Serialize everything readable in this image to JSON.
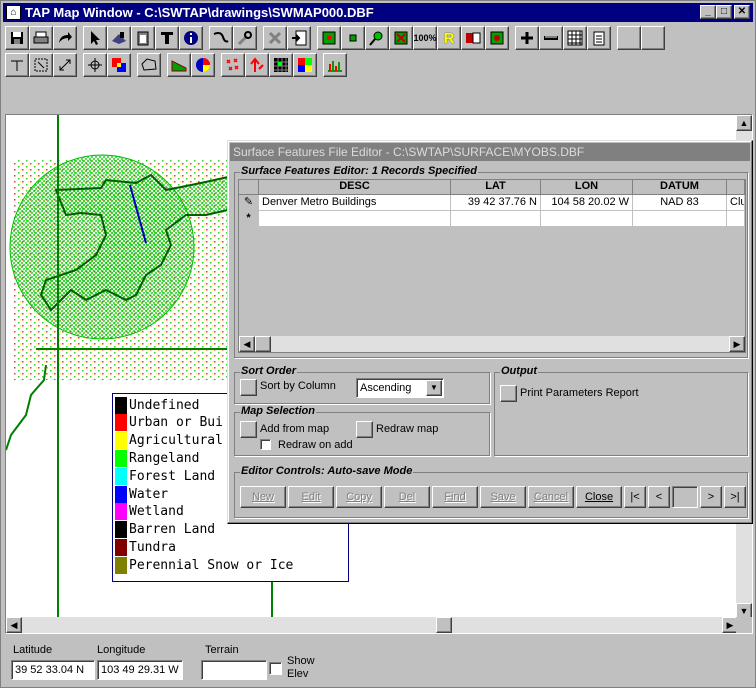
{
  "window": {
    "title": "TAP Map Window - C:\\SWTAP\\drawings\\SWMAP000.DBF",
    "minimize": "_",
    "maximize": "□",
    "close": "✕"
  },
  "toolbar1": [
    "save-icon",
    "print-icon",
    "redo-icon",
    "pointer-icon",
    "pan-icon",
    "clipboard-icon",
    "text-icon",
    "info-icon",
    "route-icon",
    "tools-icon",
    "delete-icon",
    "import-icon",
    "layer-grid-icon",
    "point-icon",
    "locate-icon",
    "remove-icon",
    "zoom-100-icon",
    "label-r-icon",
    "export-icon",
    "grid-icon",
    "add-icon",
    "ruler-icon",
    "table-icon",
    "notes-icon",
    "blank-icon",
    "blank-icon"
  ],
  "toolbar1_labels": {
    "zoom100": "100%",
    "label_r": "R"
  },
  "toolbar2": [
    "line-icon",
    "select-box-icon",
    "resize-icon",
    "move-icon",
    "layers-icon",
    "polygon-icon",
    "profile-icon",
    "globe-icon",
    "points-icon",
    "elevation-icon",
    "grid-color-icon",
    "terrain-icon",
    "histogram-icon"
  ],
  "legend": {
    "items": [
      {
        "label": "Undefined",
        "color": "#000000"
      },
      {
        "label": "Urban or Bui",
        "color": "#ff0000"
      },
      {
        "label": "Agricultural",
        "color": "#ffff00"
      },
      {
        "label": "Rangeland",
        "color": "#00ff00"
      },
      {
        "label": "Forest Land",
        "color": "#00ffff"
      },
      {
        "label": "Water",
        "color": "#0000ff"
      },
      {
        "label": "Wetland",
        "color": "#ff00ff"
      },
      {
        "label": "Barren Land",
        "color": "#000000"
      },
      {
        "label": "Tundra",
        "color": "#800000"
      },
      {
        "label": "Perennial Snow or Ice",
        "color": "#808000"
      }
    ]
  },
  "status": {
    "latitude_label": "Latitude",
    "latitude_value": "39 52 33.04 N",
    "longitude_label": "Longitude",
    "longitude_value": "103 49 29.31 W",
    "terrain_label": "Terrain",
    "terrain_value": "",
    "show_elev_line1": "Show",
    "show_elev_line2": "Elev"
  },
  "dialog": {
    "title": "Surface Features File Editor - C:\\SWTAP\\SURFACE\\MYOBS.DBF",
    "records_group": "Surface Features Editor: 1 Records Specified",
    "columns": [
      "DESC",
      "LAT",
      "LON",
      "DATUM"
    ],
    "rows": [
      {
        "desc": "Denver Metro Buildings",
        "lat": "39 42 37.76 N",
        "lon": "104 58 20.02 W",
        "datum": "NAD 83",
        "extra": "Clu"
      }
    ],
    "new_row_marker": "*",
    "sort_group": "Sort Order",
    "sort_by_column": "Sort by Column",
    "sort_value": "Ascending",
    "output_group": "Output",
    "print_params": "Print Parameters Report",
    "map_group": "Map Selection",
    "add_from_map": "Add from map",
    "redraw_map": "Redraw map",
    "redraw_on_add": "Redraw on add",
    "editor_group": "Editor Controls: Auto-save Mode",
    "buttons": {
      "new": "New",
      "edit": "Edit",
      "copy": "Copy",
      "del": "Del",
      "find": "Find",
      "save": "Save",
      "cancel": "Cancel",
      "close": "Close"
    },
    "nav": {
      "first": "|<",
      "prev": "<",
      "next": ">",
      "last": ">|"
    }
  }
}
